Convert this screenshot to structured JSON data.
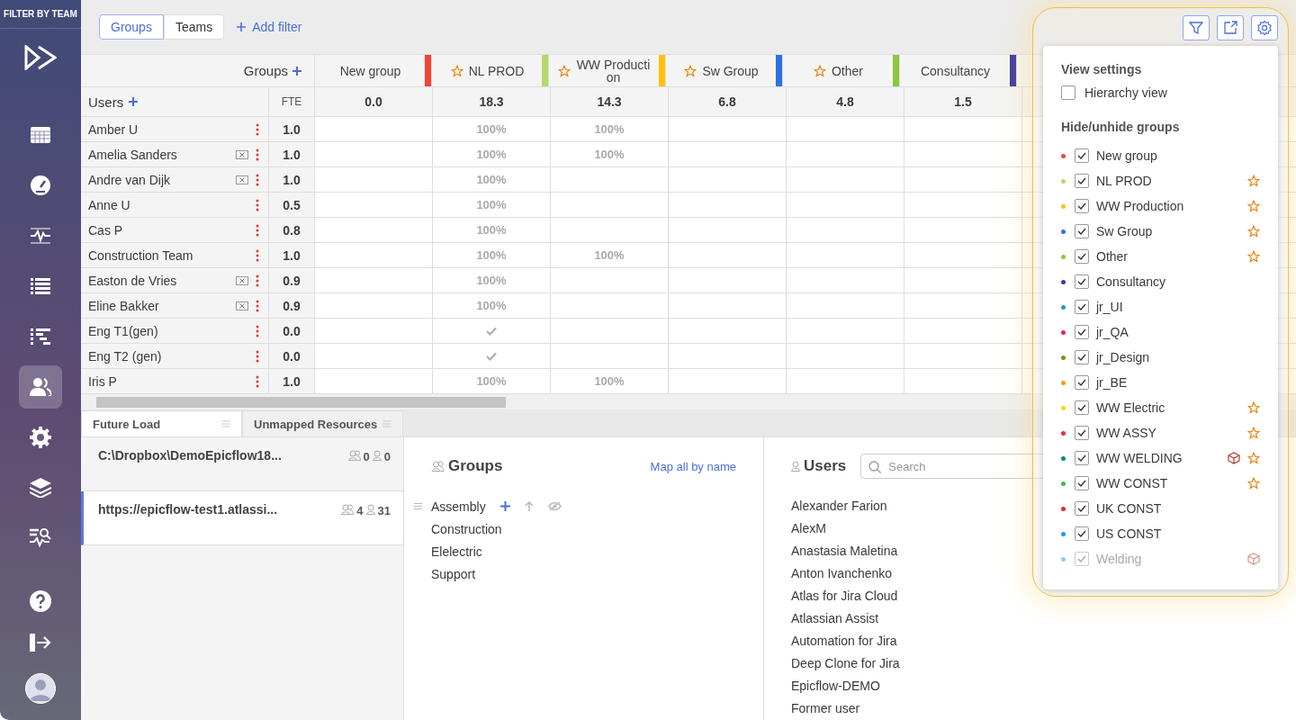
{
  "sidebar": {
    "title": "FILTER BY TEAM",
    "nav": [
      {
        "kind": "calendar",
        "selected": false
      },
      {
        "kind": "dashboard",
        "selected": false
      },
      {
        "kind": "pulse",
        "selected": false
      },
      {
        "kind": "list",
        "selected": false
      },
      {
        "kind": "gantt",
        "selected": false
      },
      {
        "kind": "users",
        "selected": true
      },
      {
        "kind": "settings",
        "selected": false
      },
      {
        "kind": "layers",
        "selected": false
      },
      {
        "kind": "analytics",
        "selected": false
      }
    ],
    "bottom": [
      {
        "kind": "help"
      },
      {
        "kind": "logout"
      },
      {
        "kind": "avatar"
      }
    ]
  },
  "filter_bar": {
    "tabs": [
      {
        "label": "Groups",
        "selected": true
      },
      {
        "label": "Teams",
        "selected": false
      }
    ],
    "add_filter": "Add filter"
  },
  "table": {
    "groups_label": "Groups",
    "users_label": "Users",
    "fte_label": "FTE",
    "columns": [
      {
        "name": "New group",
        "color": "#f44336",
        "starred": false,
        "total": "0.0"
      },
      {
        "name": "NL PROD",
        "color": "#b5d96a",
        "starred": true,
        "total": "18.3"
      },
      {
        "name": "WW Production",
        "color": "#ffc107",
        "starred": true,
        "total": "14.3"
      },
      {
        "name": "Sw Group",
        "color": "#2f6fe4",
        "starred": true,
        "total": "6.8"
      },
      {
        "name": "Other",
        "color": "#8cc63f",
        "starred": true,
        "total": "4.8"
      },
      {
        "name": "Consultancy",
        "color": "#3a3a9e",
        "starred": false,
        "total": "1.5"
      }
    ],
    "rows": [
      {
        "name": "Amber U",
        "removable": false,
        "fte": "1.0",
        "cells": [
          {
            "kind": "empty"
          },
          {
            "kind": "percent",
            "text": "100%"
          },
          {
            "kind": "percent",
            "text": "100%"
          },
          {
            "kind": "empty"
          },
          {
            "kind": "empty"
          },
          {
            "kind": "empty"
          }
        ]
      },
      {
        "name": "Amelia Sanders",
        "removable": true,
        "fte": "1.0",
        "cells": [
          {
            "kind": "empty"
          },
          {
            "kind": "percent",
            "text": "100%"
          },
          {
            "kind": "percent",
            "text": "100%"
          },
          {
            "kind": "empty"
          },
          {
            "kind": "empty"
          },
          {
            "kind": "empty"
          }
        ]
      },
      {
        "name": "Andre van Dijk",
        "removable": true,
        "fte": "1.0",
        "cells": [
          {
            "kind": "empty"
          },
          {
            "kind": "percent",
            "text": "100%"
          },
          {
            "kind": "empty"
          },
          {
            "kind": "empty"
          },
          {
            "kind": "empty"
          },
          {
            "kind": "empty"
          }
        ]
      },
      {
        "name": "Anne U",
        "removable": false,
        "fte": "0.5",
        "cells": [
          {
            "kind": "empty"
          },
          {
            "kind": "percent",
            "text": "100%"
          },
          {
            "kind": "empty"
          },
          {
            "kind": "empty"
          },
          {
            "kind": "empty"
          },
          {
            "kind": "empty"
          }
        ]
      },
      {
        "name": "Cas P",
        "removable": false,
        "fte": "0.8",
        "cells": [
          {
            "kind": "empty"
          },
          {
            "kind": "percent",
            "text": "100%"
          },
          {
            "kind": "empty"
          },
          {
            "kind": "empty"
          },
          {
            "kind": "empty"
          },
          {
            "kind": "empty"
          }
        ]
      },
      {
        "name": "Construction Team",
        "removable": false,
        "fte": "1.0",
        "cells": [
          {
            "kind": "empty"
          },
          {
            "kind": "percent",
            "text": "100%"
          },
          {
            "kind": "percent",
            "text": "100%"
          },
          {
            "kind": "empty"
          },
          {
            "kind": "empty"
          },
          {
            "kind": "empty"
          }
        ]
      },
      {
        "name": "Easton de Vries",
        "removable": true,
        "fte": "0.9",
        "cells": [
          {
            "kind": "empty"
          },
          {
            "kind": "percent",
            "text": "100%"
          },
          {
            "kind": "empty"
          },
          {
            "kind": "empty"
          },
          {
            "kind": "empty"
          },
          {
            "kind": "empty"
          }
        ]
      },
      {
        "name": "Eline Bakker",
        "removable": true,
        "fte": "0.9",
        "cells": [
          {
            "kind": "empty"
          },
          {
            "kind": "percent",
            "text": "100%"
          },
          {
            "kind": "empty"
          },
          {
            "kind": "empty"
          },
          {
            "kind": "empty"
          },
          {
            "kind": "empty"
          }
        ]
      },
      {
        "name": "Eng T1(gen)",
        "removable": false,
        "fte": "0.0",
        "cells": [
          {
            "kind": "empty"
          },
          {
            "kind": "check"
          },
          {
            "kind": "empty"
          },
          {
            "kind": "empty"
          },
          {
            "kind": "empty"
          },
          {
            "kind": "empty"
          }
        ]
      },
      {
        "name": "Eng T2 (gen)",
        "removable": false,
        "fte": "0.0",
        "cells": [
          {
            "kind": "empty"
          },
          {
            "kind": "check"
          },
          {
            "kind": "empty"
          },
          {
            "kind": "empty"
          },
          {
            "kind": "empty"
          },
          {
            "kind": "empty"
          }
        ]
      },
      {
        "name": "Iris P",
        "removable": false,
        "fte": "1.0",
        "cells": [
          {
            "kind": "empty"
          },
          {
            "kind": "percent",
            "text": "100%"
          },
          {
            "kind": "percent",
            "text": "100%"
          },
          {
            "kind": "empty"
          },
          {
            "kind": "empty"
          },
          {
            "kind": "empty"
          }
        ]
      }
    ]
  },
  "bottom_tabs": [
    {
      "label": "Future Load",
      "selected": true
    },
    {
      "label": "Unmapped Resources",
      "selected": false
    }
  ],
  "sources": [
    {
      "name": "C:\\Dropbox\\DemoEpicflow18...",
      "groups": "0",
      "users": "0",
      "selected": false
    },
    {
      "name": "https://epicflow-test1.atlassi...",
      "groups": "4",
      "users": "31",
      "selected": true
    }
  ],
  "groups_section": {
    "title": "Groups",
    "map_link": "Map all by name",
    "items": [
      {
        "name": "Assembly",
        "hovered": true
      },
      {
        "name": "Construction",
        "hovered": false
      },
      {
        "name": "Elelectric",
        "hovered": false
      },
      {
        "name": "Support",
        "hovered": false
      }
    ]
  },
  "users_section": {
    "title": "Users",
    "search": {
      "placeholder": "Search"
    },
    "items": [
      "Alexander Farion",
      "AlexM",
      "Anastasia Maletina",
      "Anton Ivanchenko",
      "Atlas for Jira Cloud",
      "Atlassian Assist",
      "Automation for Jira",
      "Deep Clone for Jira",
      "Epicflow-DEMO",
      "Former user"
    ]
  },
  "settings_panel": {
    "view_title": "View settings",
    "hierarchy": {
      "label": "Hierarchy view",
      "checked": false
    },
    "groups_title": "Hide/unhide groups",
    "groups": [
      {
        "name": "New group",
        "color": "#f44336",
        "checked": true,
        "starred": false,
        "cube": false,
        "disabled": false
      },
      {
        "name": "NL PROD",
        "color": "#b5d96a",
        "checked": true,
        "starred": true,
        "cube": false,
        "disabled": false
      },
      {
        "name": "WW Production",
        "color": "#ffc107",
        "checked": true,
        "starred": true,
        "cube": false,
        "disabled": false
      },
      {
        "name": "Sw Group",
        "color": "#2f6fe4",
        "checked": true,
        "starred": true,
        "cube": false,
        "disabled": false
      },
      {
        "name": "Other",
        "color": "#8cc63f",
        "checked": true,
        "starred": true,
        "cube": false,
        "disabled": false
      },
      {
        "name": "Consultancy",
        "color": "#3a3a9e",
        "checked": true,
        "starred": false,
        "cube": false,
        "disabled": false
      },
      {
        "name": "jr_UI",
        "color": "#2e9aa8",
        "checked": true,
        "starred": false,
        "cube": false,
        "disabled": false
      },
      {
        "name": "jr_QA",
        "color": "#e91e63",
        "checked": true,
        "starred": false,
        "cube": false,
        "disabled": false
      },
      {
        "name": "jr_Design",
        "color": "#6b9a0f",
        "checked": true,
        "starred": false,
        "cube": false,
        "disabled": false
      },
      {
        "name": "jr_BE",
        "color": "#ff9800",
        "checked": true,
        "starred": false,
        "cube": false,
        "disabled": false
      },
      {
        "name": "WW Electric",
        "color": "#ffd600",
        "checked": true,
        "starred": true,
        "cube": false,
        "disabled": false
      },
      {
        "name": "WW ASSY",
        "color": "#f0283c",
        "checked": true,
        "starred": true,
        "cube": false,
        "disabled": false
      },
      {
        "name": "WW WELDING",
        "color": "#00897b",
        "checked": true,
        "starred": true,
        "cube": true,
        "disabled": false
      },
      {
        "name": "WW CONST",
        "color": "#4caf50",
        "checked": true,
        "starred": true,
        "cube": false,
        "disabled": false
      },
      {
        "name": "UK CONST",
        "color": "#f0283c",
        "checked": true,
        "starred": false,
        "cube": false,
        "disabled": false
      },
      {
        "name": "US CONST",
        "color": "#2196f3",
        "checked": true,
        "starred": false,
        "cube": false,
        "disabled": false
      },
      {
        "name": "Welding",
        "color": "#90caf9",
        "checked": true,
        "starred": false,
        "cube": true,
        "disabled": true
      }
    ]
  }
}
